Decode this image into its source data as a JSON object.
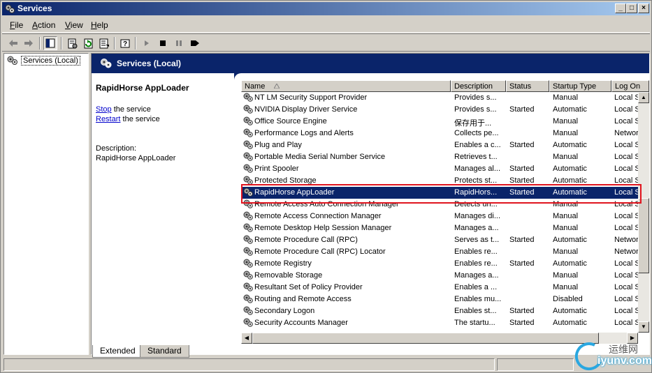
{
  "window": {
    "title": "Services"
  },
  "menu": [
    {
      "key": "F",
      "rest": "ile"
    },
    {
      "key": "A",
      "rest": "ction"
    },
    {
      "key": "V",
      "rest": "iew"
    },
    {
      "key": "H",
      "rest": "elp"
    }
  ],
  "toolbar": {
    "icons": [
      "back-arrow-icon",
      "forward-arrow-icon",
      "show-hide-tree-icon",
      "properties-icon",
      "refresh-icon",
      "export-list-icon",
      "help-icon",
      "start-service-icon",
      "stop-service-icon",
      "pause-service-icon",
      "restart-service-icon"
    ]
  },
  "tree": {
    "root_label": "Services (Local)"
  },
  "pane": {
    "title": "Services (Local)",
    "selected_name": "RapidHorse AppLoader",
    "stop_link": "Stop",
    "stop_rest": " the service",
    "restart_link": "Restart",
    "restart_rest": " the service",
    "description_label": "Description:",
    "description_value": "RapidHorse AppLoader"
  },
  "columns": [
    "Name",
    "Description",
    "Status",
    "Startup Type",
    "Log On"
  ],
  "rows": [
    {
      "name": "NT LM Security Support Provider",
      "desc": "Provides s...",
      "status": "",
      "startup": "Manual",
      "logon": "Local S"
    },
    {
      "name": "NVIDIA Display Driver Service",
      "desc": "Provides s...",
      "status": "Started",
      "startup": "Automatic",
      "logon": "Local S"
    },
    {
      "name": "Office Source Engine",
      "desc": "保存用于...",
      "status": "",
      "startup": "Manual",
      "logon": "Local S"
    },
    {
      "name": "Performance Logs and Alerts",
      "desc": "Collects pe...",
      "status": "",
      "startup": "Manual",
      "logon": "Networ"
    },
    {
      "name": "Plug and Play",
      "desc": "Enables a c...",
      "status": "Started",
      "startup": "Automatic",
      "logon": "Local S"
    },
    {
      "name": "Portable Media Serial Number Service",
      "desc": "Retrieves t...",
      "status": "",
      "startup": "Manual",
      "logon": "Local S"
    },
    {
      "name": "Print Spooler",
      "desc": "Manages al...",
      "status": "Started",
      "startup": "Automatic",
      "logon": "Local S"
    },
    {
      "name": "Protected Storage",
      "desc": "Protects st...",
      "status": "Started",
      "startup": "Automatic",
      "logon": "Local S"
    },
    {
      "name": "RapidHorse AppLoader",
      "desc": "RapidHors...",
      "status": "Started",
      "startup": "Automatic",
      "logon": "Local S",
      "selected": true
    },
    {
      "name": "Remote Access Auto Connection Manager",
      "desc": "Detects un...",
      "status": "",
      "startup": "Manual",
      "logon": "Local S"
    },
    {
      "name": "Remote Access Connection Manager",
      "desc": "Manages di...",
      "status": "",
      "startup": "Manual",
      "logon": "Local S"
    },
    {
      "name": "Remote Desktop Help Session Manager",
      "desc": "Manages a...",
      "status": "",
      "startup": "Manual",
      "logon": "Local S"
    },
    {
      "name": "Remote Procedure Call (RPC)",
      "desc": "Serves as t...",
      "status": "Started",
      "startup": "Automatic",
      "logon": "Networ"
    },
    {
      "name": "Remote Procedure Call (RPC) Locator",
      "desc": "Enables re...",
      "status": "",
      "startup": "Manual",
      "logon": "Networ"
    },
    {
      "name": "Remote Registry",
      "desc": "Enables re...",
      "status": "Started",
      "startup": "Automatic",
      "logon": "Local S"
    },
    {
      "name": "Removable Storage",
      "desc": "Manages a...",
      "status": "",
      "startup": "Manual",
      "logon": "Local S"
    },
    {
      "name": "Resultant Set of Policy Provider",
      "desc": "Enables a ...",
      "status": "",
      "startup": "Manual",
      "logon": "Local S"
    },
    {
      "name": "Routing and Remote Access",
      "desc": "Enables mu...",
      "status": "",
      "startup": "Disabled",
      "logon": "Local S"
    },
    {
      "name": "Secondary Logon",
      "desc": "Enables st...",
      "status": "Started",
      "startup": "Automatic",
      "logon": "Local S"
    },
    {
      "name": "Security Accounts Manager",
      "desc": "The startu...",
      "status": "Started",
      "startup": "Automatic",
      "logon": "Local S"
    }
  ],
  "tabs": [
    {
      "label": "Extended",
      "active": true
    },
    {
      "label": "Standard",
      "active": false
    }
  ],
  "watermark": {
    "cn": "运维网",
    "en": "iyunv.com"
  },
  "colors": {
    "title_start": "#0a246a",
    "title_end": "#a6caf0",
    "selection": "#0a246a",
    "highlight_frame": "#e0141e"
  }
}
